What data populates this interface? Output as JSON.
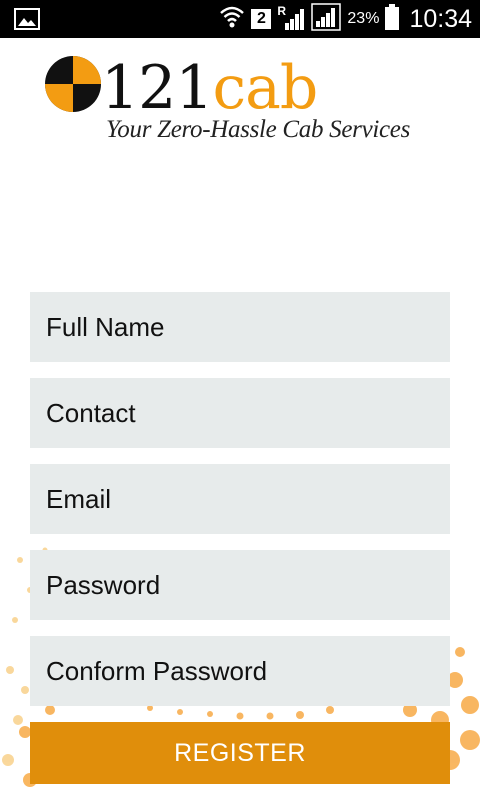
{
  "status_bar": {
    "sim_badge": "2",
    "roaming": "R",
    "battery_percent": "23%",
    "time": "10:34",
    "icons": [
      "image-notification-icon",
      "wifi-icon",
      "sim-2-icon",
      "roaming-signal-icon",
      "signal-icon",
      "battery-icon"
    ]
  },
  "brand": {
    "name_number": "121",
    "name_word": "cab",
    "tagline": "Your Zero-Hassle Cab Services",
    "accent_color": "#f39c12"
  },
  "form": {
    "fields": [
      {
        "placeholder": "Full Name"
      },
      {
        "placeholder": "Contact"
      },
      {
        "placeholder": "Email"
      },
      {
        "placeholder": "Password"
      },
      {
        "placeholder": "Conform Password"
      }
    ],
    "submit_label": "REGISTER",
    "button_color": "#e08e0b",
    "field_color": "#e7ebeb"
  }
}
